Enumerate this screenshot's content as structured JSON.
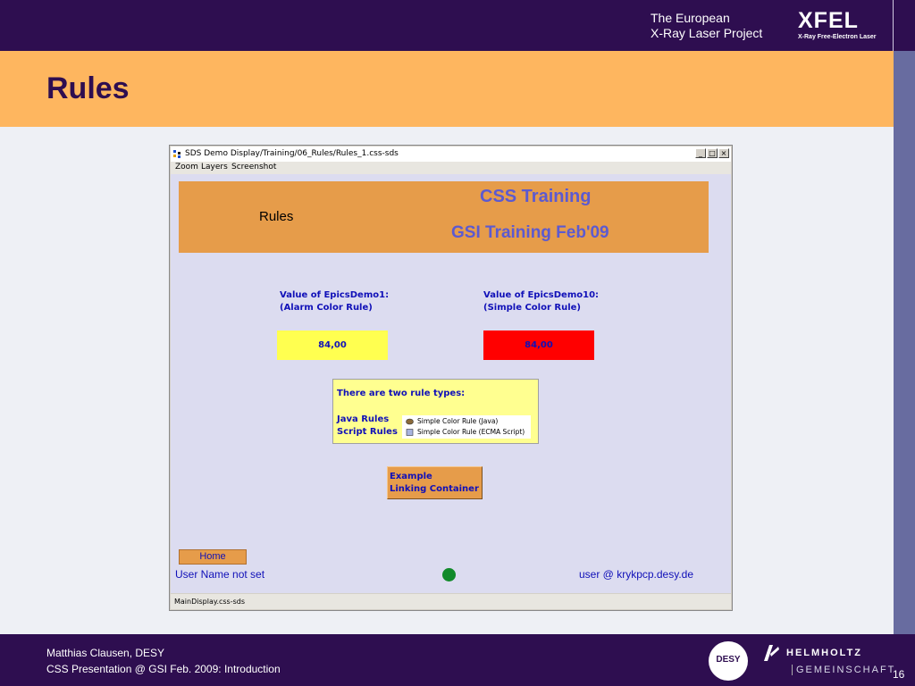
{
  "header": {
    "project_line1": "The European",
    "project_line2": "X-Ray Laser Project",
    "logo_text": "XFEL",
    "logo_subtext": "X-Ray Free-Electron Laser"
  },
  "slide": {
    "title": "Rules",
    "page_number": "16"
  },
  "footer": {
    "author": "Matthias Clausen, DESY",
    "talk": "CSS Presentation @ GSI Feb. 2009: Introduction",
    "desy_logo_text": "DESY",
    "helmholtz_line1": "HELMHOLTZ",
    "helmholtz_line2": "GEMEINSCHAFT"
  },
  "window": {
    "title": "SDS Demo Display/Training/06_Rules/Rules_1.css-sds",
    "buttons": {
      "minimize": "_",
      "maximize": "□",
      "close": "×"
    },
    "menu": [
      "Zoom",
      "Layers",
      "Screenshot"
    ],
    "status": "MainDisplay.css-sds"
  },
  "display": {
    "panel_left": "Rules",
    "panel_title": "CSS Training",
    "panel_subtitle": "GSI Training Feb'09",
    "demo1_label_1": "Value of EpicsDemo1:",
    "demo1_label_2": "(Alarm Color Rule)",
    "demo1_value": "84,00",
    "demo10_label_1": "Value of EpicsDemo10:",
    "demo10_label_2": "(Simple Color Rule)",
    "demo10_value": "84,00",
    "rules_info_title": "There are two rule types:",
    "java_rules": "Java Rules",
    "script_rules": "Script Rules",
    "java_item": "Simple Color Rule (Java)",
    "script_item": "Simple Color Rule (ECMA Script)",
    "example_line1": "Example",
    "example_line2": "Linking Container",
    "home": "Home",
    "user_name": "User Name not set",
    "user_host": "user @ krykpcp.desy.de"
  },
  "colors": {
    "demo1_box": "#ffff50",
    "demo10_box": "#ff0000",
    "status_led": "#118a2a"
  }
}
